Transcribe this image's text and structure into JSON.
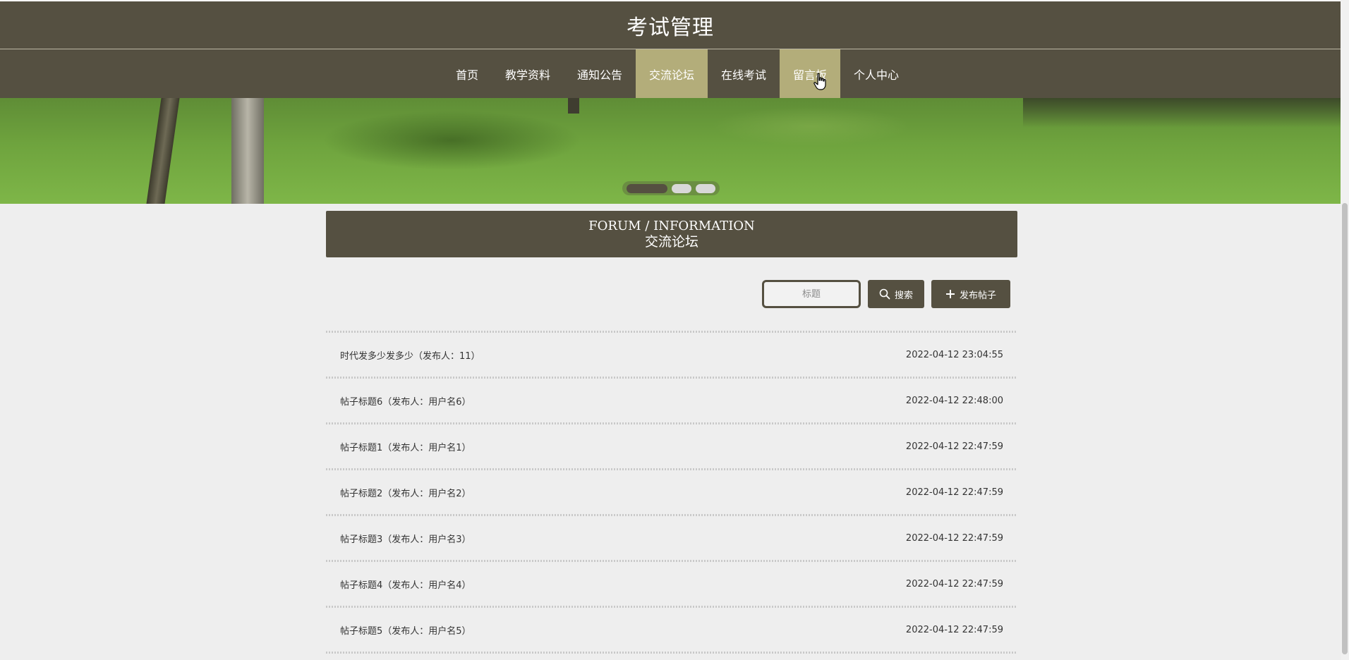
{
  "header": {
    "title": "考试管理"
  },
  "nav": {
    "items": [
      {
        "label": "首页"
      },
      {
        "label": "教学资料"
      },
      {
        "label": "通知公告"
      },
      {
        "label": "交流论坛"
      },
      {
        "label": "在线考试"
      },
      {
        "label": "留言板"
      },
      {
        "label": "个人中心"
      }
    ],
    "active_label": "交流论坛",
    "hovered_label": "留言板"
  },
  "banner": {
    "slide_count": 3,
    "active_slide": 1
  },
  "section": {
    "title_en": "FORUM / INFORMATION",
    "title_cn": "交流论坛"
  },
  "search": {
    "placeholder": "标题",
    "search_label": "搜索",
    "add_label": "发布帖子",
    "search_icon": "search-icon",
    "add_icon": "plus-icon"
  },
  "posts": [
    {
      "title": "时代发多少发多少（发布人：11）",
      "date": "2022-04-12 23:04:55"
    },
    {
      "title": "帖子标题6（发布人：用户名6）",
      "date": "2022-04-12 22:48:00"
    },
    {
      "title": "帖子标题1（发布人：用户名1）",
      "date": "2022-04-12 22:47:59"
    },
    {
      "title": "帖子标题2（发布人：用户名2）",
      "date": "2022-04-12 22:47:59"
    },
    {
      "title": "帖子标题3（发布人：用户名3）",
      "date": "2022-04-12 22:47:59"
    },
    {
      "title": "帖子标题4（发布人：用户名4）",
      "date": "2022-04-12 22:47:59"
    },
    {
      "title": "帖子标题5（发布人：用户名5）",
      "date": "2022-04-12 22:47:59"
    }
  ],
  "colors": {
    "brand": "#555041",
    "accent": "#b3ad7a",
    "background": "#eeeeee"
  }
}
